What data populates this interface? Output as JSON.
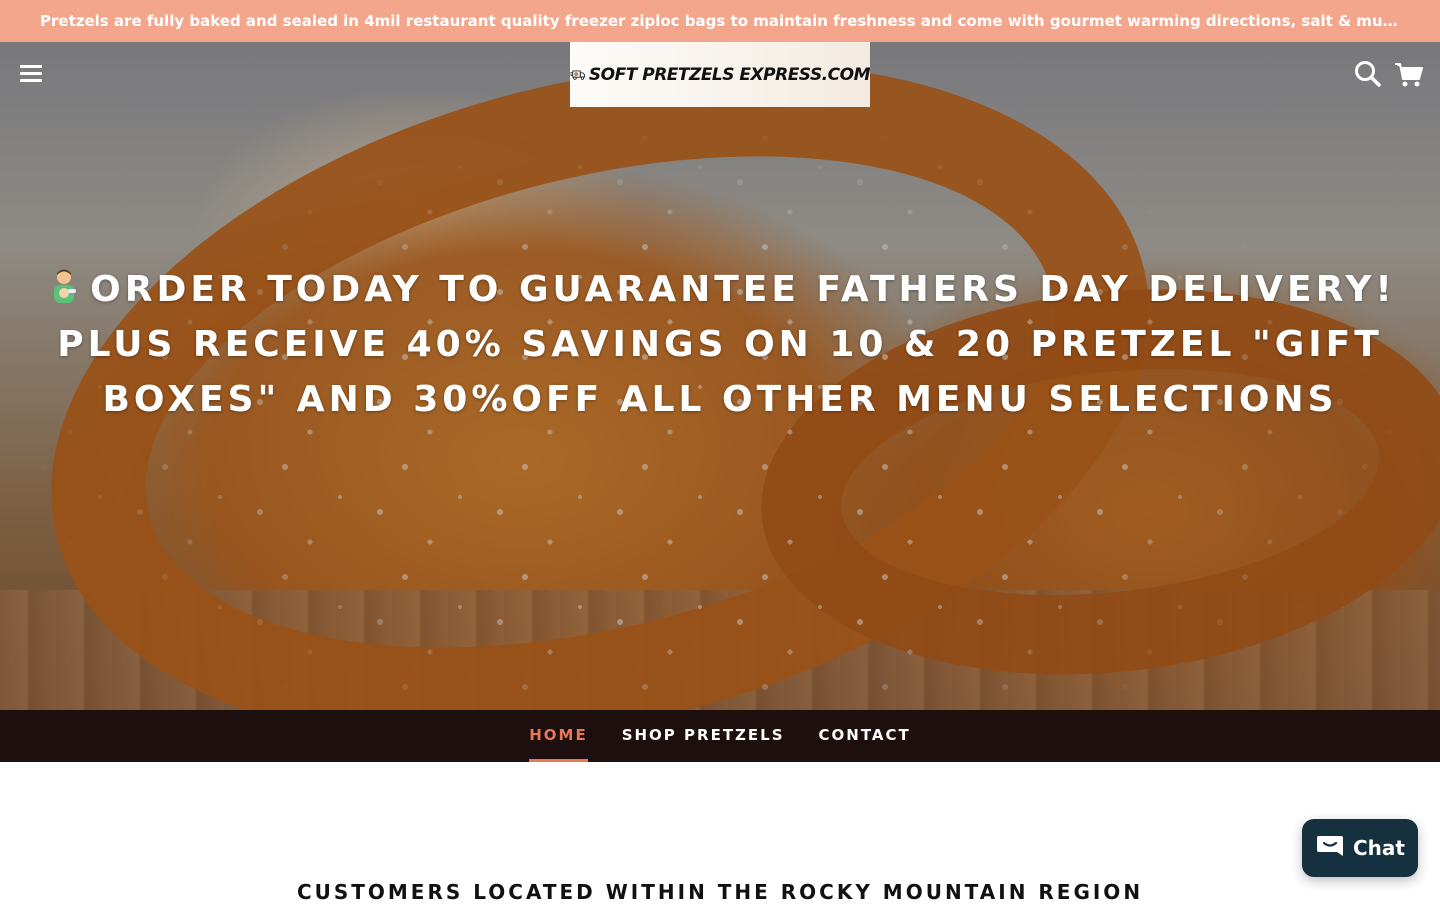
{
  "announcement": {
    "text": "Pretzels are fully baked and sealed in 4mil restaurant quality freezer ziploc bags to maintain freshness and come with gourmet warming directions, salt & mustard..."
  },
  "header": {
    "logo_text": "SOFT PRETZELS EXPRESS.COM",
    "menu_icon": "hamburger-menu-icon",
    "search_icon": "search-icon",
    "cart_icon": "cart-icon"
  },
  "hero": {
    "emoji_icon": "man-feeding-baby-icon",
    "heading": "ORDER TODAY TO GUARANTEE FATHERS DAY DELIVERY! PLUS RECEIVE 40% SAVINGS ON 10 & 20 PRETZEL \"GIFT BOXES\" AND 30%OFF ALL OTHER MENU SELECTIONS"
  },
  "nav": {
    "items": [
      {
        "label": "HOME",
        "active": true
      },
      {
        "label": "SHOP PRETZELS",
        "active": false
      },
      {
        "label": "CONTACT",
        "active": false
      }
    ]
  },
  "section": {
    "heading": "CUSTOMERS LOCATED WITHIN THE ROCKY MOUNTAIN REGION"
  },
  "chat": {
    "label": "Chat",
    "icon": "chat-bubble-icon"
  },
  "colors": {
    "announcement_bg": "#f4a68c",
    "nav_bg": "#1c0f0e",
    "nav_active": "#e8765a",
    "chat_bg": "#15303f"
  }
}
